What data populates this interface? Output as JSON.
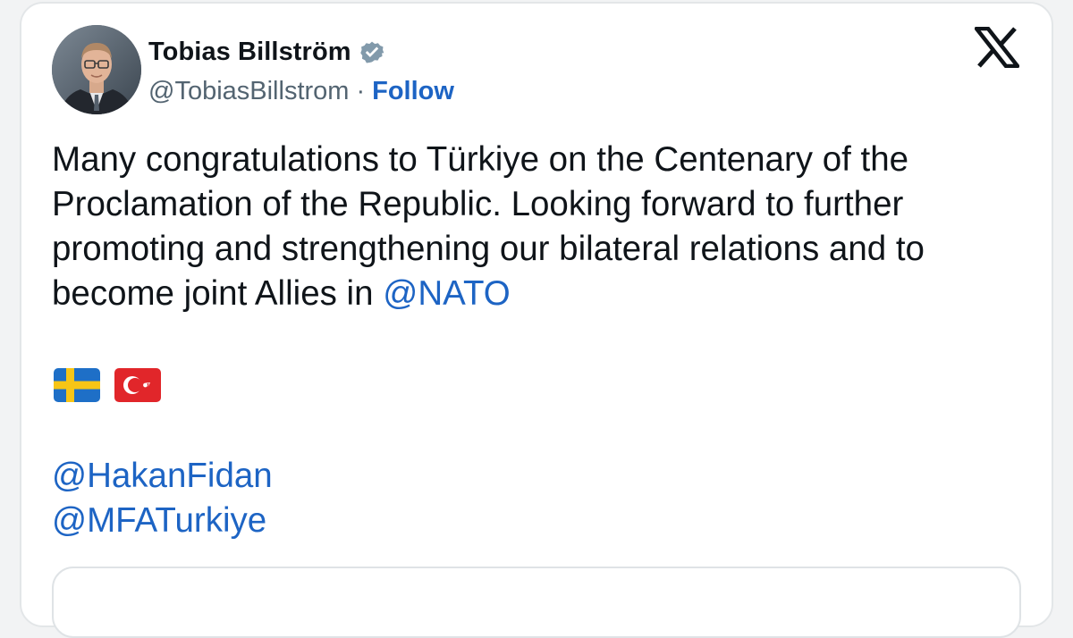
{
  "author": {
    "display_name": "Tobias Billström",
    "handle": "@TobiasBillstrom",
    "separator": "·",
    "follow_label": "Follow",
    "verified_icon": "verified-badge-icon",
    "verified_color": "#829aab"
  },
  "platform": {
    "logo_icon": "x-logo-icon"
  },
  "tweet": {
    "text": "Many congratulations to Türkiye on the Centenary of the Proclamation of the Republic. Looking forward to further promoting and strengthening our bilateral relations and to become joint Allies in ",
    "text_mention": "@NATO",
    "flags": [
      "sweden-flag-icon",
      "turkey-flag-icon"
    ],
    "mentions": [
      "@HakanFidan",
      "@MFATurkiye"
    ]
  },
  "colors": {
    "text": "#0f1419",
    "secondary_text": "#536471",
    "link": "#1d64c4",
    "card_border": "#e3e6e8"
  }
}
